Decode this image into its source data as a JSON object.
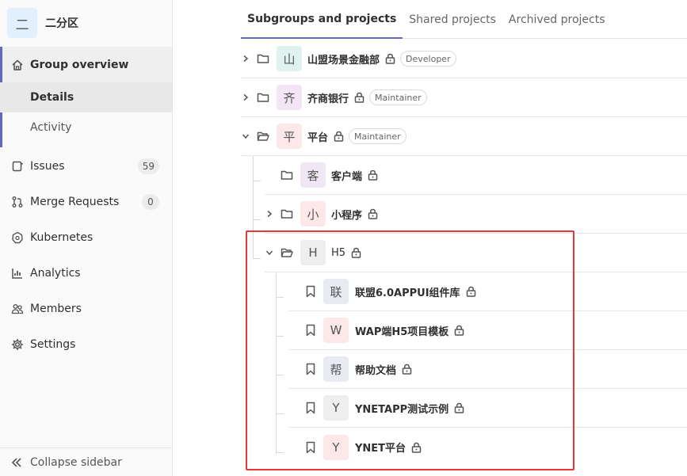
{
  "sidebar": {
    "context_avatar": "二",
    "context_title": "二分区",
    "items": [
      {
        "label": "Group overview",
        "icon": "home-icon"
      },
      {
        "label": "Details"
      },
      {
        "label": "Activity"
      },
      {
        "label": "Issues",
        "icon": "issues-icon",
        "count": "59"
      },
      {
        "label": "Merge Requests",
        "icon": "merge-request-icon",
        "count": "0"
      },
      {
        "label": "Kubernetes",
        "icon": "kubernetes-icon"
      },
      {
        "label": "Analytics",
        "icon": "chart-icon"
      },
      {
        "label": "Members",
        "icon": "users-icon"
      },
      {
        "label": "Settings",
        "icon": "gear-icon"
      }
    ],
    "collapse_label": "Collapse sidebar"
  },
  "tabs": [
    "Subgroups and projects",
    "Shared projects",
    "Archived projects"
  ],
  "tree": [
    {
      "avatar": "山",
      "name": "山盟场景金融部",
      "role": "Developer",
      "avatar_bg": "#e0f2ef"
    },
    {
      "avatar": "齐",
      "name": "齐商银行",
      "role": "Maintainer",
      "avatar_bg": "#f3e5f5"
    },
    {
      "avatar": "平",
      "name": "平台",
      "role": "Maintainer",
      "avatar_bg": "#fce8e8"
    },
    {
      "avatar": "客",
      "name": "客户端",
      "avatar_bg": "#efe7f6"
    },
    {
      "avatar": "小",
      "name": "小程序",
      "avatar_bg": "#fce8e8"
    },
    {
      "avatar": "H",
      "name": "H5",
      "avatar_bg": "#eeeeee"
    },
    {
      "avatar": "联",
      "name": "联盟6.0APPUI组件库",
      "avatar_bg": "#e8eaf4"
    },
    {
      "avatar": "W",
      "name": "WAP端H5项目模板",
      "avatar_bg": "#fce8e8"
    },
    {
      "avatar": "帮",
      "name": "帮助文档",
      "avatar_bg": "#e8eaf4"
    },
    {
      "avatar": "Y",
      "name": "YNETAPP测试示例",
      "avatar_bg": "#eeeeee"
    },
    {
      "avatar": "Y",
      "name": "YNET平台",
      "avatar_bg": "#fce8e8"
    }
  ]
}
